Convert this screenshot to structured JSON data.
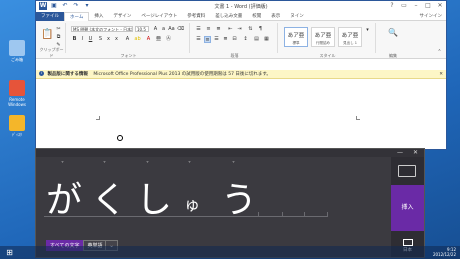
{
  "desktop": {
    "icons": [
      {
        "name": "recycle-bin",
        "label": "ごみ箱",
        "color": "#9ec7f0"
      },
      {
        "name": "app-shortcut",
        "label": "Remote Windows",
        "color": "#e6543a"
      },
      {
        "name": "app-shortcut-2",
        "label": "ﾃﾞｨｽｸ",
        "color": "#f4b62a"
      }
    ]
  },
  "word": {
    "title": "文書 1 - Word (評価版)",
    "user": "サインイン",
    "tabs": [
      "ファイル",
      "ホーム",
      "挿入",
      "デザイン",
      "ページレイアウト",
      "参考資料",
      "差し込み文書",
      "校閲",
      "表示",
      "ヌイン"
    ],
    "active_tab": "ホーム",
    "font_name": "MS 明朝 (本文のフォント - 日本語)",
    "font_size": "10.5",
    "group_labels": [
      "クリップボード",
      "フォント",
      "段落",
      "スタイル",
      "編集"
    ],
    "styles": [
      {
        "sample": "あア亜",
        "name": "標準"
      },
      {
        "sample": "あア亜",
        "name": "行間詰め"
      },
      {
        "sample": "あア亜",
        "name": "見出し 1"
      }
    ],
    "infobar": {
      "title": "製品版に関する情報",
      "message": "Microsoft Office Professional Plus 2013 の試用版の使用期限は 57 日後に切れます。"
    }
  },
  "handwriting": {
    "recognized": [
      "が",
      "く",
      "し",
      "ゅ",
      "う"
    ],
    "candidate_marks": [
      "˅",
      "˅",
      "˅",
      "˅",
      "˅"
    ],
    "insert_label": "挿入",
    "language_label": "日本",
    "options": [
      "すべての文字",
      "英単語"
    ],
    "selected_option": "すべての文字",
    "accent_color": "#6a2aa6"
  },
  "taskbar": {
    "time": "9:12",
    "date": "2012/12/22"
  }
}
